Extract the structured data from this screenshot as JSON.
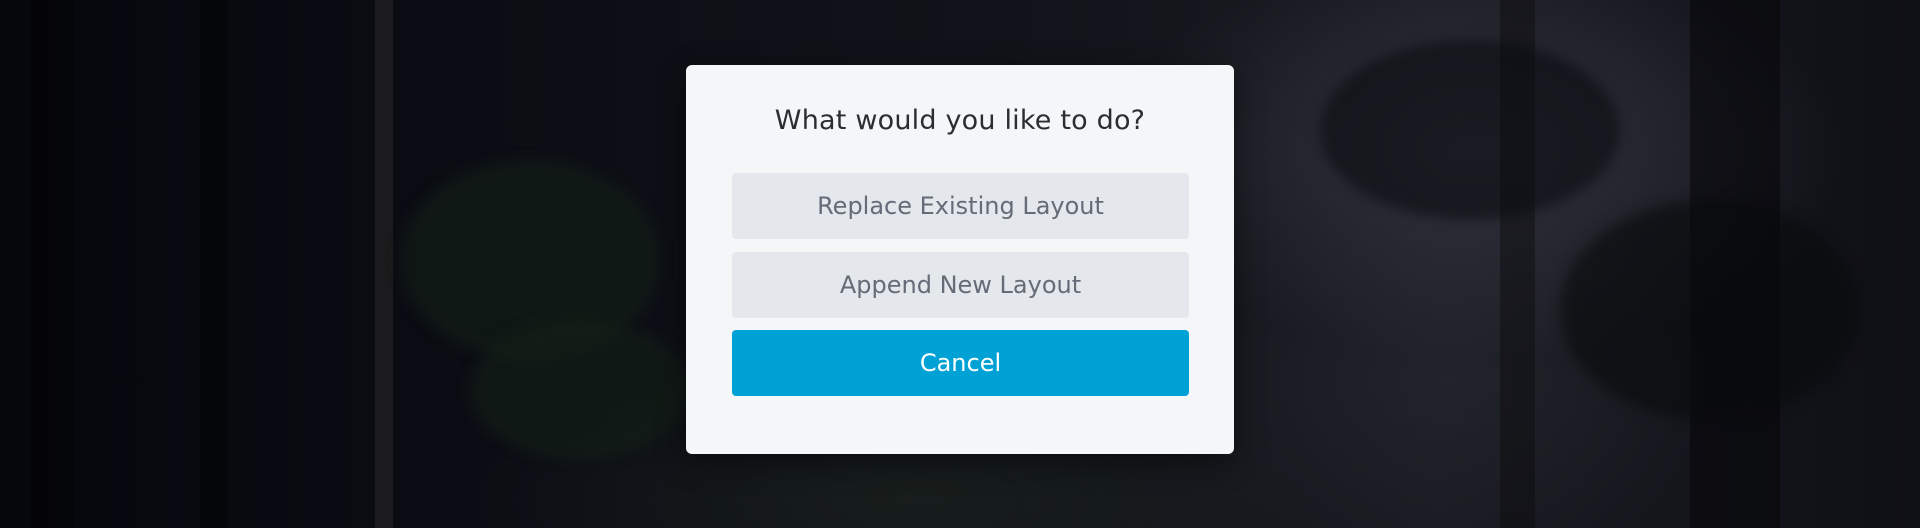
{
  "dialog": {
    "title": "What would you like to do?",
    "buttons": {
      "replace_label": "Replace Existing Layout",
      "append_label": "Append New Layout",
      "cancel_label": "Cancel"
    }
  },
  "colors": {
    "primary": "#00a2d5",
    "secondary_bg": "#e4e7eb",
    "modal_bg": "#f4f6f8"
  }
}
